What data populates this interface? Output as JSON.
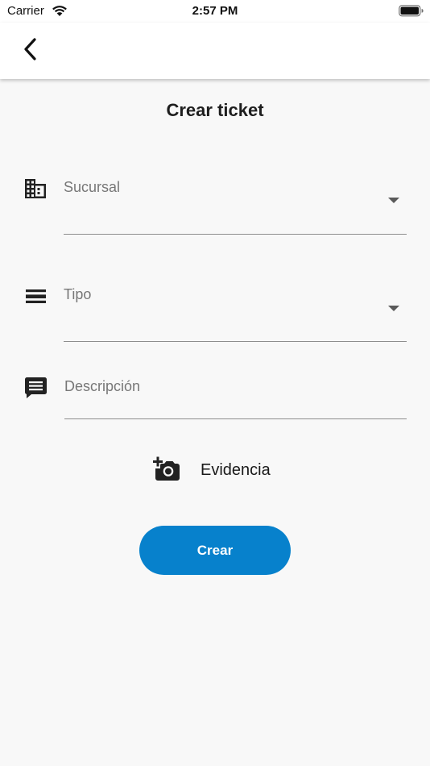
{
  "status_bar": {
    "carrier": "Carrier",
    "time": "2:57 PM"
  },
  "app_bar": {
    "back_icon": "chevron-left-icon"
  },
  "page": {
    "title": "Crear ticket"
  },
  "form": {
    "sucursal": {
      "label": "Sucursal",
      "icon": "building-icon",
      "type": "dropdown"
    },
    "tipo": {
      "label": "Tipo",
      "icon": "list-icon",
      "type": "dropdown"
    },
    "descripcion": {
      "label": "Descripción",
      "icon": "comment-icon",
      "type": "text"
    },
    "evidencia": {
      "label": "Evidencia",
      "icon": "add-photo-icon"
    },
    "submit_label": "Crear"
  },
  "colors": {
    "accent": "#0781cc",
    "background": "#f8f8f8",
    "app_bar": "#ffffff"
  }
}
